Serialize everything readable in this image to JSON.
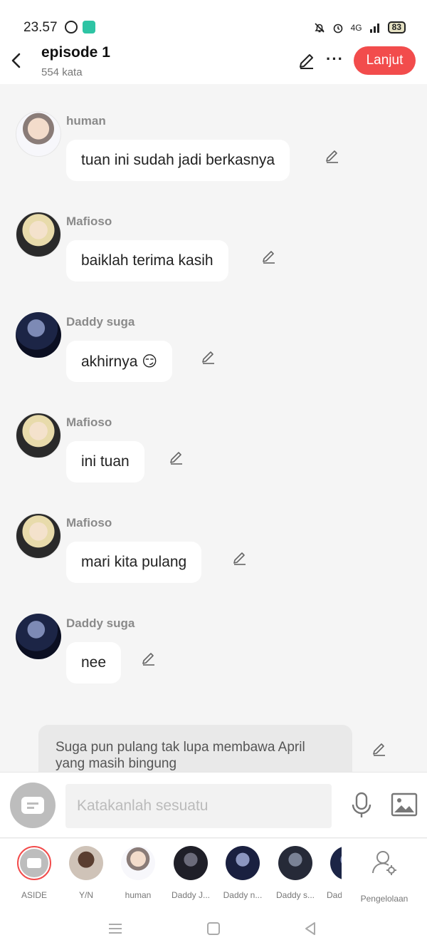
{
  "status_bar": {
    "time": "23.57",
    "network": "4G",
    "battery": "83"
  },
  "header": {
    "title": "episode 1",
    "word_count": "554 kata",
    "next_label": "Lanjut"
  },
  "messages": [
    {
      "sender": "human",
      "text": "tuan ini sudah jadi berkasnya"
    },
    {
      "sender": "Mafioso",
      "text": "baiklah terima kasih"
    },
    {
      "sender": "Daddy suga",
      "text": "akhirnya 😏"
    },
    {
      "sender": "Mafioso",
      "text": "ini tuan"
    },
    {
      "sender": "Mafioso",
      "text": "mari kita pulang"
    },
    {
      "sender": "Daddy suga",
      "text": "nee"
    }
  ],
  "narration": {
    "text": "Suga pun pulang tak lupa membawa April yang masih bingung"
  },
  "input": {
    "placeholder": "Katakanlah sesuatu"
  },
  "characters": [
    {
      "label": "ASIDE"
    },
    {
      "label": "Y/N"
    },
    {
      "label": "human"
    },
    {
      "label": "Daddy J..."
    },
    {
      "label": "Daddy n..."
    },
    {
      "label": "Daddy s..."
    },
    {
      "label": "Dad"
    }
  ],
  "manage_label": "Pengelolaan",
  "colors": {
    "accent": "#f24c4c",
    "background": "#f5f5f5",
    "bubble": "#ffffff"
  }
}
